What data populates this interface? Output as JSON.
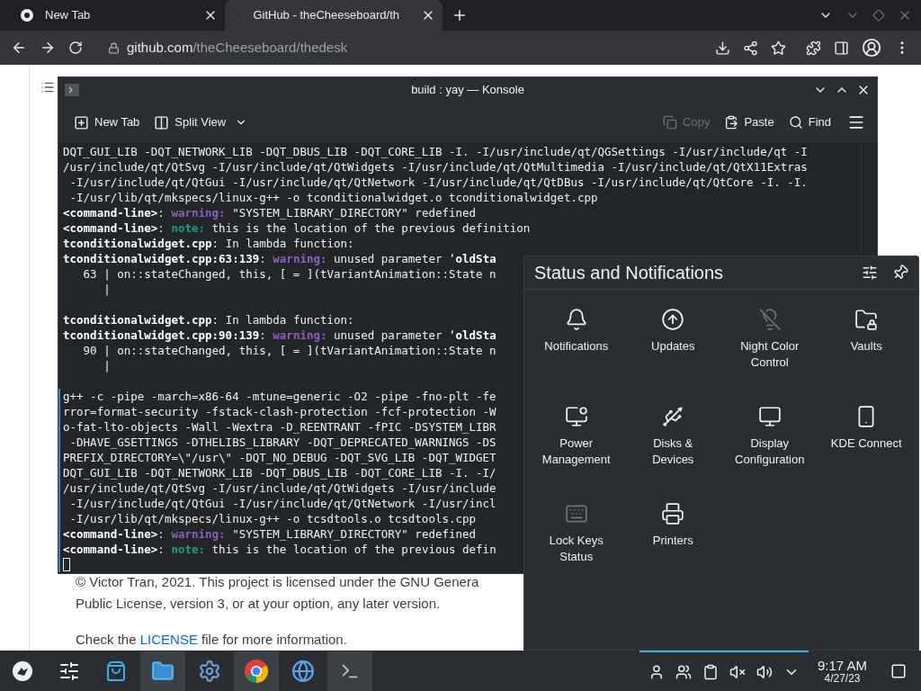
{
  "browser": {
    "tabs": [
      {
        "title": "New Tab",
        "kind": "newtab",
        "selected": false
      },
      {
        "title": "GitHub - theCheeseboard/th",
        "kind": "github",
        "selected": true
      }
    ],
    "url": {
      "domain": "github.com",
      "path": "/theCheeseboard/thedesk"
    }
  },
  "page": {
    "license_line_1": "© Victor Tran, 2021. This project is licensed under the GNU Genera",
    "license_line_2": "Public License, version 3, or at your option, any later version.",
    "license_note": {
      "before": "Check the ",
      "link": "LICENSE",
      "after": " file for more information."
    }
  },
  "konsole": {
    "title": "build : yay — Konsole",
    "toolbar_left": [
      {
        "label": "New Tab",
        "kind": "newtab",
        "disabled": false
      },
      {
        "label": "Split View",
        "kind": "split",
        "disabled": false
      }
    ],
    "toolbar_right": [
      {
        "label": "Copy",
        "kind": "copy",
        "disabled": true
      },
      {
        "label": "Paste",
        "kind": "paste",
        "disabled": false
      },
      {
        "label": "Find",
        "kind": "find",
        "disabled": false
      }
    ],
    "lines": [
      {
        "kind": "text",
        "marked": false,
        "segments": [
          {
            "kind": "plain",
            "text": "DQT_GUI_LIB -DQT_NETWORK_LIB -DQT_DBUS_LIB -DQT_CORE_LIB -I. -I/usr/include/qt/QGSettings -I/usr/include/qt -I"
          }
        ]
      },
      {
        "kind": "text",
        "marked": false,
        "segments": [
          {
            "kind": "plain",
            "text": "/usr/include/qt/QtSvg -I/usr/include/qt/QtWidgets -I/usr/include/qt/QtMultimedia -I/usr/include/qt/QtX11Extras"
          }
        ]
      },
      {
        "kind": "text",
        "marked": false,
        "segments": [
          {
            "kind": "plain",
            "text": " -I/usr/include/qt/QtGui -I/usr/include/qt/QtNetwork -I/usr/include/qt/QtDBus -I/usr/include/qt/QtCore -I. -I."
          }
        ]
      },
      {
        "kind": "text",
        "marked": false,
        "segments": [
          {
            "kind": "plain",
            "text": " -I/usr/lib/qt/mkspecs/linux-g++ -o tconditionalwidget.o tconditionalwidget.cpp"
          }
        ]
      },
      {
        "kind": "text",
        "marked": false,
        "segments": [
          {
            "kind": "bold",
            "text": "<command-line>"
          },
          {
            "kind": "plain",
            "text": ": "
          },
          {
            "kind": "warning",
            "text": "warning:"
          },
          {
            "kind": "plain",
            "text": " \"SYSTEM_LIBRARY_DIRECTORY\" redefined"
          }
        ]
      },
      {
        "kind": "text",
        "marked": false,
        "segments": [
          {
            "kind": "bold",
            "text": "<command-line>"
          },
          {
            "kind": "plain",
            "text": ": "
          },
          {
            "kind": "note",
            "text": "note:"
          },
          {
            "kind": "plain",
            "text": " this is the location of the previous definition"
          }
        ]
      },
      {
        "kind": "text",
        "marked": false,
        "segments": [
          {
            "kind": "bold",
            "text": "tconditionalwidget.cpp"
          },
          {
            "kind": "plain",
            "text": ": In lambda function:"
          }
        ]
      },
      {
        "kind": "text",
        "marked": false,
        "segments": [
          {
            "kind": "bold",
            "text": "tconditionalwidget.cpp:63:139"
          },
          {
            "kind": "plain",
            "text": ": "
          },
          {
            "kind": "warning",
            "text": "warning:"
          },
          {
            "kind": "plain",
            "text": " unused parameter ‘"
          },
          {
            "kind": "bold",
            "text": "oldSta"
          }
        ]
      },
      {
        "kind": "text",
        "marked": false,
        "segments": [
          {
            "kind": "plain",
            "text": "   63 | on::stateChanged, this, [ = ](tVariantAnimation::State n"
          }
        ]
      },
      {
        "kind": "text",
        "marked": false,
        "segments": [
          {
            "kind": "plain",
            "text": "      |"
          }
        ]
      },
      {
        "kind": "blank",
        "marked": false
      },
      {
        "kind": "text",
        "marked": false,
        "segments": [
          {
            "kind": "bold",
            "text": "tconditionalwidget.cpp"
          },
          {
            "kind": "plain",
            "text": ": In lambda function:"
          }
        ]
      },
      {
        "kind": "text",
        "marked": false,
        "segments": [
          {
            "kind": "bold",
            "text": "tconditionalwidget.cpp:90:139"
          },
          {
            "kind": "plain",
            "text": ": "
          },
          {
            "kind": "warning",
            "text": "warning:"
          },
          {
            "kind": "plain",
            "text": " unused parameter ‘"
          },
          {
            "kind": "bold",
            "text": "oldSta"
          }
        ]
      },
      {
        "kind": "text",
        "marked": false,
        "segments": [
          {
            "kind": "plain",
            "text": "   90 | on::stateChanged, this, [ = ](tVariantAnimation::State n"
          }
        ]
      },
      {
        "kind": "text",
        "marked": false,
        "segments": [
          {
            "kind": "plain",
            "text": "      |"
          }
        ]
      },
      {
        "kind": "blank",
        "marked": false
      },
      {
        "kind": "text",
        "marked": true,
        "segments": [
          {
            "kind": "plain",
            "text": "g++ -c -pipe -march=x86-64 -mtune=generic -O2 -pipe -fno-plt -fe"
          }
        ]
      },
      {
        "kind": "text",
        "marked": true,
        "segments": [
          {
            "kind": "plain",
            "text": "rror=format-security -fstack-clash-protection -fcf-protection -W"
          }
        ]
      },
      {
        "kind": "text",
        "marked": true,
        "segments": [
          {
            "kind": "plain",
            "text": "o-fat-lto-objects -Wall -Wextra -D_REENTRANT -fPIC -DSYSTEM_LIBR"
          }
        ]
      },
      {
        "kind": "text",
        "marked": true,
        "segments": [
          {
            "kind": "plain",
            "text": " -DHAVE_GSETTINGS -DTHELIBS_LIBRARY -DQT_DEPRECATED_WARNINGS -DS"
          }
        ]
      },
      {
        "kind": "text",
        "marked": true,
        "segments": [
          {
            "kind": "plain",
            "text": "PREFIX_DIRECTORY=\\\"/usr\\\" -DQT_NO_DEBUG -DQT_SVG_LIB -DQT_WIDGET"
          }
        ]
      },
      {
        "kind": "text",
        "marked": true,
        "segments": [
          {
            "kind": "plain",
            "text": "DQT_GUI_LIB -DQT_NETWORK_LIB -DQT_DBUS_LIB -DQT_CORE_LIB -I. -I/"
          }
        ]
      },
      {
        "kind": "text",
        "marked": true,
        "segments": [
          {
            "kind": "plain",
            "text": "/usr/include/qt/QtSvg -I/usr/include/qt/QtWidgets -I/usr/include"
          }
        ]
      },
      {
        "kind": "text",
        "marked": true,
        "segments": [
          {
            "kind": "plain",
            "text": " -I/usr/include/qt/QtGui -I/usr/include/qt/QtNetwork -I/usr/incl"
          }
        ]
      },
      {
        "kind": "text",
        "marked": true,
        "segments": [
          {
            "kind": "plain",
            "text": " -I/usr/lib/qt/mkspecs/linux-g++ -o tcsdtools.o tcsdtools.cpp"
          }
        ]
      },
      {
        "kind": "text",
        "marked": true,
        "segments": [
          {
            "kind": "bold",
            "text": "<command-line>"
          },
          {
            "kind": "plain",
            "text": ": "
          },
          {
            "kind": "warning",
            "text": "warning:"
          },
          {
            "kind": "plain",
            "text": " \"SYSTEM_LIBRARY_DIRECTORY\" redefined"
          }
        ]
      },
      {
        "kind": "text",
        "marked": true,
        "segments": [
          {
            "kind": "bold",
            "text": "<command-line>"
          },
          {
            "kind": "plain",
            "text": ": "
          },
          {
            "kind": "note",
            "text": "note:"
          },
          {
            "kind": "plain",
            "text": " this is the location of the previous defin"
          }
        ]
      },
      {
        "kind": "cursor",
        "marked": true
      }
    ]
  },
  "status_panel": {
    "title": "Status and Notifications",
    "items": [
      {
        "label": "Notifications",
        "kind": "bell",
        "dimmed": false
      },
      {
        "label": "Updates",
        "kind": "updates",
        "dimmed": false
      },
      {
        "label": "Night Color Control",
        "kind": "nightcolor",
        "dimmed": true
      },
      {
        "label": "Vaults",
        "kind": "vault",
        "dimmed": false
      },
      {
        "label": "Power Management",
        "kind": "power",
        "dimmed": false
      },
      {
        "label": "Disks & Devices",
        "kind": "disk",
        "dimmed": false
      },
      {
        "label": "Display Configuration",
        "kind": "display",
        "dimmed": false
      },
      {
        "label": "KDE Connect",
        "kind": "phone",
        "dimmed": false
      },
      {
        "label": "Lock Keys Status",
        "kind": "lockkeys",
        "dimmed": true
      },
      {
        "label": "Printers",
        "kind": "printer",
        "dimmed": false
      }
    ]
  },
  "taskbar": {
    "apps": [
      {
        "kind": "launcher",
        "open": false
      },
      {
        "kind": "mixer",
        "open": false
      },
      {
        "kind": "store",
        "open": false
      },
      {
        "kind": "files",
        "open": true
      },
      {
        "kind": "settings",
        "open": false
      },
      {
        "kind": "browser",
        "open": true
      },
      {
        "kind": "network",
        "open": false
      },
      {
        "kind": "terminal",
        "open": true
      }
    ],
    "tray_expanded": true,
    "time": "9:17 AM",
    "date": "4/27/23"
  }
}
